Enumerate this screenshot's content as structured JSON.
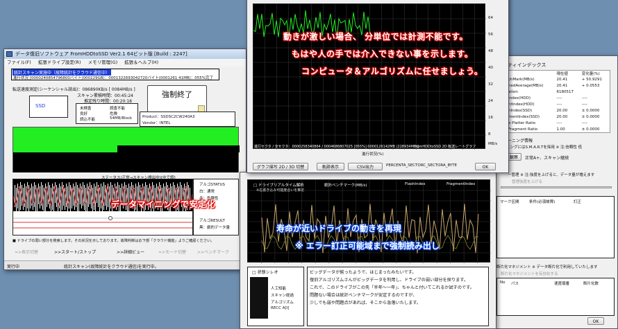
{
  "main_window": {
    "title": "データ復旧ソフトウェア FromHDDtoSSD Ver2.1 64ビット版 [Build : 2247]",
    "menu": [
      "ファイル(F)",
      "拡張ドライブ設定(R)",
      "メモリ管理(G)",
      "拡張＆ヘルプ(H)"
    ],
    "scan_status": "統計スキャン実施中（故障統計をクラウド通信中）",
    "progress_line": "進行状況 [0000240854796800バイト(000229GB)：0001322693042720バイト(0001261 41MB)：055%完了",
    "transfer_label": "転送速度測定(シーケンシャル読出)：086890KB/s [ 0084MB/s ]",
    "scan_elapsed": "スキャン累積時間：00:45:24",
    "scan_remaining": "推定残り時間：00:20:18",
    "force_stop": "強制終了",
    "ssd_label": "SSD",
    "legend": [
      "未検査",
      "調査不能",
      "良好",
      "危険",
      "読込不能",
      "54MB/Block"
    ],
    "product": "Product：SSDSC2CW240A3",
    "vendor": "Vendor：INTEL",
    "status_caption": "ステータス(正常→スキャン検出中)[中で調]",
    "algo_status": "アルゴSTATUS",
    "algo_status_white": "白：通常",
    "algo_status_red": "赤：危険性",
    "algo_result": "アルゴRESULT",
    "algo_result_black": "黒：劇的データ量",
    "note": "■ ドライブの弱い部分を検索します。その状況を示しております。故障判断はお下部「クラウド機能」よりご確認ください。",
    "bottom_buttons": [
      "=>表示切替",
      ">>スタート/ストップ",
      ">>詳細ビュー",
      "=>モード切替",
      ">>ベンチマーク"
    ],
    "statusbar_left": "実行中",
    "statusbar_right": "統計スキャン(故障統計をクラウド通信)を実行中。"
  },
  "graph_window": {
    "y_ticks": [
      "64",
      "56",
      "48",
      "40",
      "32",
      "24",
      "16",
      "8"
    ],
    "y_unit": "MB/s",
    "sector_footer": "進行セクタ / 全セクタ：0000258340864 / 0004686807025 [055%] 0000126142MB (228934MB)]",
    "footer_right": "FromHDDtoSSD 2D 転送レートグラフ",
    "progress_label": "進行状況(%)",
    "buttons": [
      "グラフ描写 2D / 3D 切替",
      "軌跡表示",
      "CSV出力"
    ],
    "csv_field": "PERCENTA_SECTORC_SECTORA_BYTE",
    "ok": "OK"
  },
  "banners": {
    "red_line1": "動きが激しい場合、 分単位では計測不能です。",
    "red_line2": "もはや人の手では介入できない事を示します。",
    "red_line3": "コンピュータ＆アルゴリズムに任せましょう。",
    "red_mid": "データマイニングで安定化",
    "blue_line1": "寿命が近いドライブの動きを再現",
    "blue_line2": "※ エラー訂正可能域まで強制読み出し"
  },
  "analysis_window": {
    "legend_left": "ドライブリアルタイム解析",
    "legend_sub": "※右書き込み可能度合いを推定",
    "legend_bench": "統計ベンチマーク(MB/s)",
    "legend_flash": "FlashIndex",
    "legend_frag": "FragmentIndex",
    "status_title": "状態シレオ",
    "status_items": [
      "人工知能",
      "スキャン経過",
      "アルゴリズム",
      "RECC A[I]"
    ],
    "ai_text": [
      "ビッグデータが揃ったようで、はじまったみたいです。",
      "復旧アルゴリズムさんがビッグデータを利用し、ドライブの弱い部分を探ります。",
      "これで、このドライブがこの先「半年～一年」、ちゃんと付いてこれるか試すのです。",
      "問題ない場合は統計ベンチマークが安定するのですが、",
      "少しでも弱や問題点があれば、そこから急落いたします。"
    ]
  },
  "stats_panel": {
    "title": "ティインデックス",
    "headers": [
      "",
      "現在値",
      "変化量(%)"
    ],
    "rows": [
      [
        "chMark(MB/s)",
        "20.41",
        "+ 50.9291"
      ],
      [
        "hedAverage(MB/s)",
        "20.41",
        "+ 0.0553"
      ],
      [
        "ation",
        "6180517",
        ""
      ],
      [
        "Index(HDD)",
        "----",
        "----"
      ],
      [
        "ntIndex(HDD)",
        "----",
        "----"
      ],
      [
        "hIndex(SSD)",
        "20.00",
        "± 0.0000"
      ],
      [
        "mentIndex(SSD)",
        "20.00",
        "± 0.0000"
      ],
      [
        "e Platter Ratio",
        "----",
        "----"
      ],
      [
        "Fragment Ratio",
        "1.00",
        "± 0.0000"
      ]
    ],
    "section_learn": "ーニング情報",
    "learn_note": "ニングにはS.M.A.R.Tを採用 ※ 注:信頼性 低",
    "learn_btn": "観察",
    "learn_value": "正常A+、スキャン継続",
    "section_mgmt": "ー管理 ※ 注:強度を上げると、データ量が増えます",
    "mgmt_item": "管理強度を上げる",
    "table_headers": [
      "マーク区間",
      "条件(必須故障)",
      "訂正"
    ],
    "section_bottom": "断片化マネジメント ※ データ断片化で利用していたします",
    "bottom_note": "断片化マネジメントを有効化する",
    "bottom_headers": [
      "No",
      "パス",
      "速度順番",
      "断片化数"
    ],
    "ok": "OK"
  }
}
